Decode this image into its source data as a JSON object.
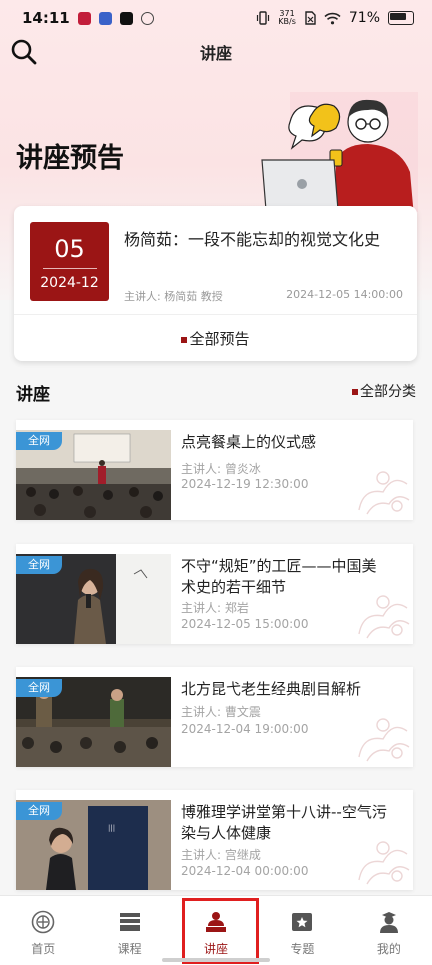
{
  "status_bar": {
    "time": "14:11",
    "net_speed_value": "371",
    "net_speed_unit": "KB/s",
    "battery": "71%"
  },
  "header": {
    "title": "讲座",
    "search_icon": "search-icon"
  },
  "hero": {
    "title": "讲座预告"
  },
  "featured": {
    "day": "05",
    "month": "2024-12",
    "title": "杨简茹：一段不能忘却的视觉文化史",
    "speaker": "主讲人: 杨简茹 教授",
    "time": "2024-12-05 14:00:00",
    "all_label": "全部预告"
  },
  "section": {
    "title": "讲座",
    "all_categories": "全部分类"
  },
  "lectures": [
    {
      "badge": "全网",
      "title": "点亮餐桌上的仪式感",
      "speaker": "主讲人: 曾炎冰",
      "time": "2024-12-19 12:30:00"
    },
    {
      "badge": "全网",
      "title": "不守“规矩”的工匠——中国美术史的若干细节",
      "speaker": "主讲人: 郑岩",
      "time": "2024-12-05 15:00:00"
    },
    {
      "badge": "全网",
      "title": "北方昆弋老生经典剧目解析",
      "speaker": "主讲人: 曹文震",
      "time": "2024-12-04 19:00:00"
    },
    {
      "badge": "全网",
      "title": "博雅理学讲堂第十八讲--空气污染与人体健康",
      "speaker": "主讲人: 宫继成",
      "time": "2024-12-04 00:00:00"
    }
  ],
  "bottom_nav": [
    {
      "label": "首页",
      "icon": "university-seal-icon"
    },
    {
      "label": "课程",
      "icon": "course-icon"
    },
    {
      "label": "讲座",
      "icon": "lecturer-icon"
    },
    {
      "label": "专题",
      "icon": "star-film-icon"
    },
    {
      "label": "我的",
      "icon": "profile-icon"
    }
  ],
  "colors": {
    "brand_red": "#9b1515",
    "badge_blue": "#3b95d6",
    "active_outline": "#e01f1f"
  }
}
